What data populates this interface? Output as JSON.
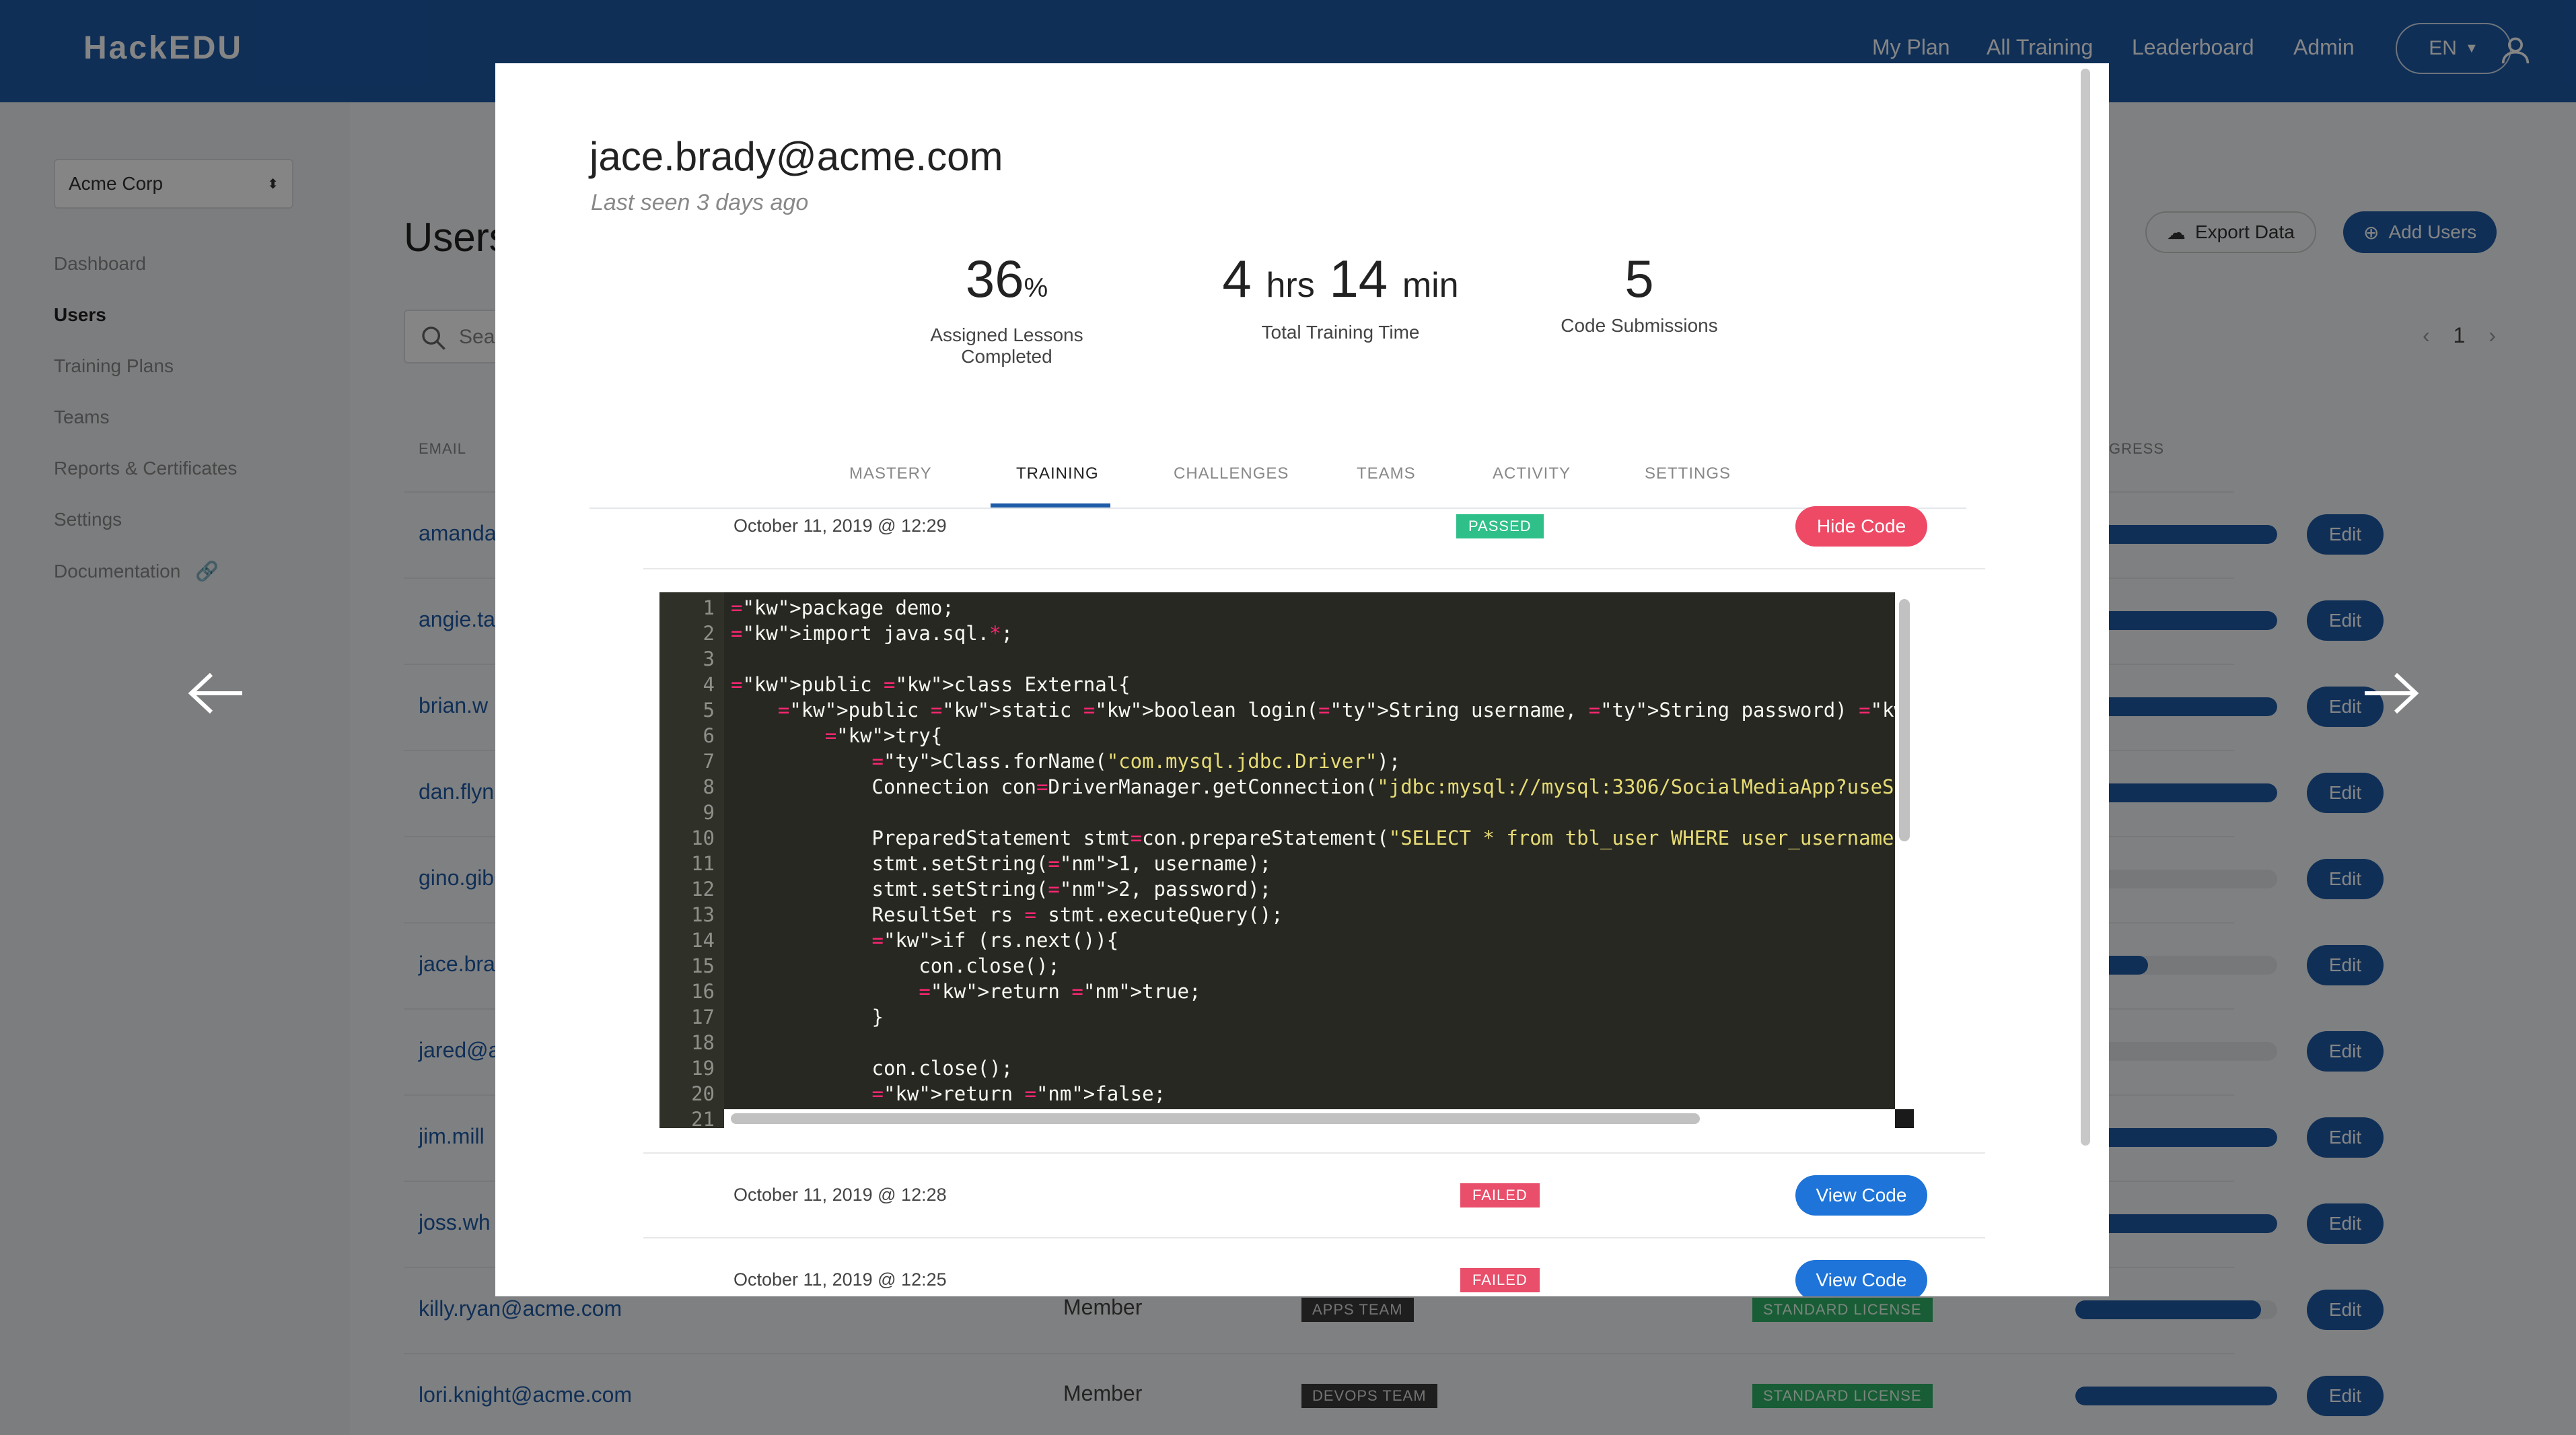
{
  "app": {
    "logo": "HackEDU",
    "nav": [
      "My Plan",
      "All Training",
      "Leaderboard",
      "Admin"
    ],
    "language": "EN"
  },
  "sidebar": {
    "org_select": "Acme Corp",
    "items": [
      "Dashboard",
      "Users",
      "Training Plans",
      "Teams",
      "Reports & Certificates",
      "Settings",
      "Documentation"
    ]
  },
  "page": {
    "title": "Users",
    "search_placeholder": "Sea",
    "export_label": "Export Data",
    "add_users_label": "Add Users",
    "page_number": "1",
    "col_email": "EMAIL",
    "col_progress": "GRESS"
  },
  "users": [
    {
      "email": "amanda",
      "progress": 1.0
    },
    {
      "email": "angie.ta",
      "progress": 1.0
    },
    {
      "email": "brian.w",
      "progress": 1.0
    },
    {
      "email": "dan.flyn",
      "progress": 1.0
    },
    {
      "email": "gino.gib",
      "progress": 0.0
    },
    {
      "email": "jace.bra",
      "progress": 0.36
    },
    {
      "email": "jared@a",
      "progress": 0.0
    },
    {
      "email": "jim.mill",
      "progress": 1.0
    },
    {
      "email": "joss.wh",
      "progress": 1.0
    },
    {
      "email": "killy.ryan@acme.com",
      "role": "Member",
      "team": "APPS TEAM",
      "license": "STANDARD LICENSE",
      "progress": 0.92
    },
    {
      "email": "lori.knight@acme.com",
      "role": "Member",
      "team": "DEVOPS TEAM",
      "license": "STANDARD LICENSE",
      "progress": 1.0
    }
  ],
  "edit_label": "Edit",
  "modal": {
    "email": "jace.brady@acme.com",
    "last_seen": "Last seen 3 days ago",
    "stats": {
      "lessons_value": "36",
      "lessons_unit": "%",
      "lessons_label": "Assigned Lessons Completed",
      "time_hrs": "4",
      "time_hrs_unit": "hrs",
      "time_min": "14",
      "time_min_unit": "min",
      "time_label": "Total Training Time",
      "submissions_value": "5",
      "submissions_label": "Code Submissions"
    },
    "tabs": [
      "MASTERY",
      "TRAINING",
      "CHALLENGES",
      "TEAMS",
      "ACTIVITY",
      "SETTINGS"
    ],
    "active_tab": "TRAINING",
    "submissions": [
      {
        "date": "October 11, 2019 @ 12:29",
        "status": "PASSED",
        "button": "Hide Code"
      },
      {
        "date": "October 11, 2019 @ 12:28",
        "status": "FAILED",
        "button": "View Code"
      },
      {
        "date": "October 11, 2019 @ 12:25",
        "status": "FAILED",
        "button": "View Code"
      }
    ],
    "code_lines": [
      "package demo;",
      "import java.sql.*;",
      "",
      "public class External{",
      "    public static boolean login(String username, String password) throws Exception{",
      "        try{",
      "            Class.forName(\"com.mysql.jdbc.Driver\");",
      "            Connection con=DriverManager.getConnection(\"jdbc:mysql://mysql:3306/SocialMediaApp?useSSL=fa",
      "",
      "            PreparedStatement stmt=con.prepareStatement(\"SELECT * from tbl_user WHERE user_username =? A",
      "            stmt.setString(1, username);",
      "            stmt.setString(2, password);",
      "            ResultSet rs = stmt.executeQuery();",
      "            if (rs.next()){",
      "                con.close();",
      "                return true;",
      "            }",
      "",
      "            con.close();",
      "            return false;",
      ""
    ]
  },
  "colors": {
    "brand": "#1e5ba8",
    "passed": "#2fc08a",
    "failed": "#e94e6a",
    "hide": "#ee4a66",
    "view": "#1e74d8"
  },
  "icons": [
    "cloud-download-icon",
    "plus-circle-icon",
    "user-icon",
    "arrow-left-icon",
    "arrow-right-icon",
    "search-icon",
    "link-icon"
  ]
}
